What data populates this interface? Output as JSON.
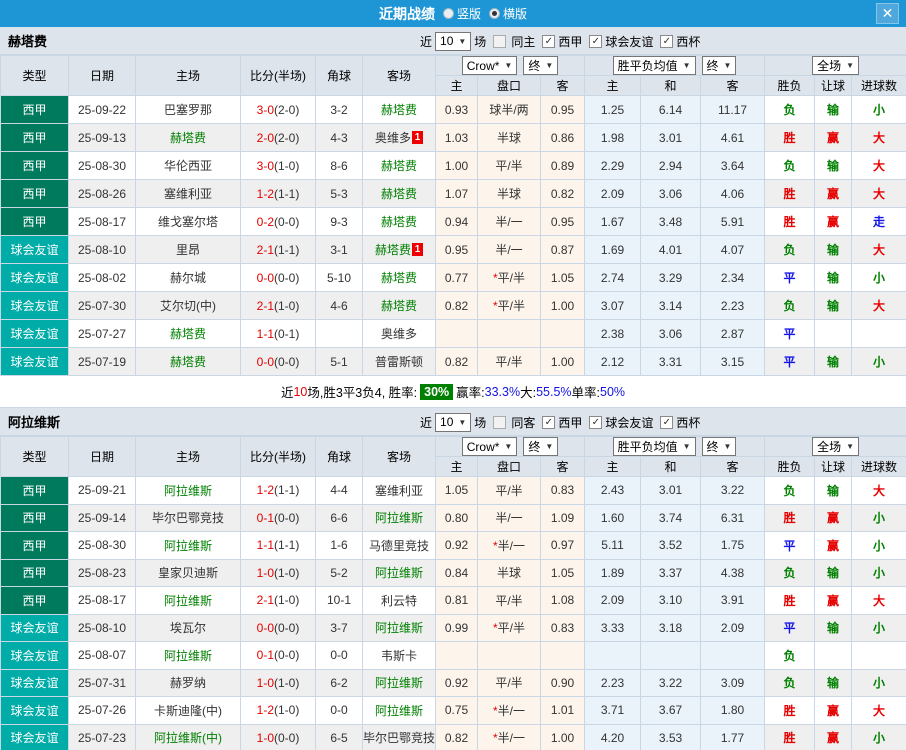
{
  "titlebar": {
    "title": "近期战绩",
    "radio_vertical": "竖版",
    "radio_horizontal": "横版",
    "close": "✕"
  },
  "filters": {
    "near": "近",
    "count": "10",
    "games": "场",
    "league_liga": "西甲",
    "league_friendly": "球会友谊",
    "league_cup": "西杯"
  },
  "columns": {
    "type": "类型",
    "date": "日期",
    "home": "主场",
    "score": "比分(半场)",
    "corner": "角球",
    "away": "客场",
    "dd_bookmaker": "Crow*",
    "dd_final1": "终",
    "dd_avg": "胜平负均值",
    "dd_final2": "终",
    "dd_fulltime": "全场",
    "sub_h": "主",
    "sub_handicap": "盘口",
    "sub_a": "客",
    "sub_w": "主",
    "sub_d": "和",
    "sub_l": "客",
    "sub_wl": "胜负",
    "sub_let": "让球",
    "sub_goals": "进球数"
  },
  "sections": [
    {
      "team": "赫塔费",
      "same_label": "同主",
      "rows": [
        [
          "西甲",
          "25-09-22",
          "巴塞罗那",
          "",
          "3-0",
          "(2-0)",
          "3-2",
          "赫塔费",
          "g",
          "0.93",
          "球半/两",
          "0.95",
          "1.25",
          "6.14",
          "11.17",
          "负|g",
          "输|g",
          "小|g"
        ],
        [
          "西甲",
          "25-09-13",
          "赫塔费",
          "g",
          "2-0",
          "(2-0)",
          "4-3",
          "奥维多",
          "c",
          "1.03",
          "半球",
          "0.86",
          "1.98",
          "3.01",
          "4.61",
          "胜|r",
          "赢|r",
          "大|r"
        ],
        [
          "西甲",
          "25-08-30",
          "华伦西亚",
          "",
          "3-0",
          "(1-0)",
          "8-6",
          "赫塔费",
          "g",
          "1.00",
          "平/半",
          "0.89",
          "2.29",
          "2.94",
          "3.64",
          "负|g",
          "输|g",
          "大|r"
        ],
        [
          "西甲",
          "25-08-26",
          "塞维利亚",
          "",
          "1-2",
          "(1-1)",
          "5-3",
          "赫塔费",
          "g",
          "1.07",
          "半球",
          "0.82",
          "2.09",
          "3.06",
          "4.06",
          "胜|r",
          "赢|r",
          "大|r"
        ],
        [
          "西甲",
          "25-08-17",
          "维戈塞尔塔",
          "",
          "0-2",
          "(0-0)",
          "9-3",
          "赫塔费",
          "g",
          "0.94",
          "半/一",
          "0.95",
          "1.67",
          "3.48",
          "5.91",
          "胜|r",
          "赢|r",
          "走|b"
        ],
        [
          "球会友谊",
          "25-08-10",
          "里昂",
          "",
          "2-1",
          "(1-1)",
          "3-1",
          "赫塔费",
          "gc",
          "0.95",
          "半/一",
          "0.87",
          "1.69",
          "4.01",
          "4.07",
          "负|g",
          "输|g",
          "大|r"
        ],
        [
          "球会友谊",
          "25-08-02",
          "赫尔城",
          "",
          "0-0",
          "(0-0)",
          "5-10",
          "赫塔费",
          "g",
          "0.77",
          "*平/半",
          "1.05",
          "2.74",
          "3.29",
          "2.34",
          "平|b",
          "输|g",
          "小|g"
        ],
        [
          "球会友谊",
          "25-07-30",
          "艾尔切(中)",
          "",
          "2-1",
          "(1-0)",
          "4-6",
          "赫塔费",
          "g",
          "0.82",
          "*平/半",
          "1.00",
          "3.07",
          "3.14",
          "2.23",
          "负|g",
          "输|g",
          "大|r"
        ],
        [
          "球会友谊",
          "25-07-27",
          "赫塔费",
          "g",
          "1-1",
          "(0-1)",
          "",
          "奥维多",
          "",
          "",
          "",
          "",
          "2.38",
          "3.06",
          "2.87",
          "平|b",
          "",
          ""
        ],
        [
          "球会友谊",
          "25-07-19",
          "赫塔费",
          "g",
          "0-0",
          "(0-0)",
          "5-1",
          "普雷斯顿",
          "",
          "0.82",
          "平/半",
          "1.00",
          "2.12",
          "3.31",
          "3.15",
          "平|b",
          "输|g",
          "小|g"
        ]
      ],
      "summary": {
        "prefix": "近",
        "count": "10",
        "mid": "场,胜3平3负4, 胜率:",
        "win_rate": "30%",
        "seg2_label": "赢率:",
        "seg2_val": "33.3%",
        "seg3_label": " 大:",
        "seg3_val": "55.5%",
        "seg4_label": " 单率:",
        "seg4_val": "50%"
      }
    },
    {
      "team": "阿拉维斯",
      "same_label": "同客",
      "rows": [
        [
          "西甲",
          "25-09-21",
          "阿拉维斯",
          "g",
          "1-2",
          "(1-1)",
          "4-4",
          "塞维利亚",
          "",
          "1.05",
          "平/半",
          "0.83",
          "2.43",
          "3.01",
          "3.22",
          "负|g",
          "输|g",
          "大|r"
        ],
        [
          "西甲",
          "25-09-14",
          "毕尔巴鄂竞技",
          "",
          "0-1",
          "(0-0)",
          "6-6",
          "阿拉维斯",
          "g",
          "0.80",
          "半/一",
          "1.09",
          "1.60",
          "3.74",
          "6.31",
          "胜|r",
          "赢|r",
          "小|g"
        ],
        [
          "西甲",
          "25-08-30",
          "阿拉维斯",
          "g",
          "1-1",
          "(1-1)",
          "1-6",
          "马德里竞技",
          "",
          "0.92",
          "*半/一",
          "0.97",
          "5.11",
          "3.52",
          "1.75",
          "平|b",
          "赢|r",
          "小|g"
        ],
        [
          "西甲",
          "25-08-23",
          "皇家贝迪斯",
          "",
          "1-0",
          "(1-0)",
          "5-2",
          "阿拉维斯",
          "g",
          "0.84",
          "半球",
          "1.05",
          "1.89",
          "3.37",
          "4.38",
          "负|g",
          "输|g",
          "小|g"
        ],
        [
          "西甲",
          "25-08-17",
          "阿拉维斯",
          "g",
          "2-1",
          "(1-0)",
          "10-1",
          "利云特",
          "",
          "0.81",
          "平/半",
          "1.08",
          "2.09",
          "3.10",
          "3.91",
          "胜|r",
          "赢|r",
          "大|r"
        ],
        [
          "球会友谊",
          "25-08-10",
          "埃瓦尔",
          "",
          "0-0",
          "(0-0)",
          "3-7",
          "阿拉维斯",
          "g",
          "0.99",
          "*平/半",
          "0.83",
          "3.33",
          "3.18",
          "2.09",
          "平|b",
          "输|g",
          "小|g"
        ],
        [
          "球会友谊",
          "25-08-07",
          "阿拉维斯",
          "g",
          "0-1",
          "(0-0)",
          "0-0",
          "韦斯卡",
          "",
          "",
          "",
          "",
          "",
          "",
          "",
          "负|g",
          "",
          ""
        ],
        [
          "球会友谊",
          "25-07-31",
          "赫罗纳",
          "",
          "1-0",
          "(1-0)",
          "6-2",
          "阿拉维斯",
          "g",
          "0.92",
          "平/半",
          "0.90",
          "2.23",
          "3.22",
          "3.09",
          "负|g",
          "输|g",
          "小|g"
        ],
        [
          "球会友谊",
          "25-07-26",
          "卡斯迪隆(中)",
          "",
          "1-2",
          "(1-0)",
          "0-0",
          "阿拉维斯",
          "g",
          "0.75",
          "*半/一",
          "1.01",
          "3.71",
          "3.67",
          "1.80",
          "胜|r",
          "赢|r",
          "大|r"
        ],
        [
          "球会友谊",
          "25-07-23",
          "阿拉维斯(中)",
          "g",
          "1-0",
          "(0-0)",
          "6-5",
          "毕尔巴鄂竞技",
          "",
          "0.82",
          "*半/一",
          "1.00",
          "4.20",
          "3.53",
          "1.77",
          "胜|r",
          "赢|r",
          "小|g"
        ]
      ]
    }
  ]
}
